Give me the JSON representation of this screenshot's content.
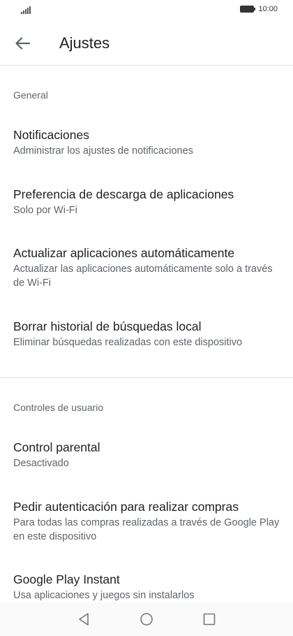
{
  "status_bar": {
    "time": "10:00"
  },
  "app_bar": {
    "title": "Ajustes"
  },
  "sections": {
    "general": {
      "header": "General"
    },
    "user_controls": {
      "header": "Controles de usuario"
    }
  },
  "items": [
    {
      "title": "Notificaciones",
      "subtitle": "Administrar los ajustes de notificaciones"
    },
    {
      "title": "Preferencia de descarga de aplicaciones",
      "subtitle": "Solo por Wi-Fi"
    },
    {
      "title": "Actualizar aplicaciones automáticamente",
      "subtitle": "Actualizar las aplicaciones automáticamente solo a través de Wi-Fi"
    },
    {
      "title": "Borrar historial de búsquedas local",
      "subtitle": "Eliminar búsquedas realizadas con este dispositivo"
    },
    {
      "title": "Control parental",
      "subtitle": "Desactivado"
    },
    {
      "title": "Pedir autenticación para realizar compras",
      "subtitle": "Para todas las compras realizadas a través de Google Play en este dispositivo"
    },
    {
      "title": "Google Play Instant",
      "subtitle": "Usa aplicaciones y juegos sin instalarlos"
    }
  ],
  "icons": {
    "back": "arrow-back-icon",
    "signal": "signal-icon",
    "battery": "battery-icon",
    "nav_back": "nav-back-icon",
    "nav_home": "nav-home-icon",
    "nav_recents": "nav-recents-icon"
  }
}
